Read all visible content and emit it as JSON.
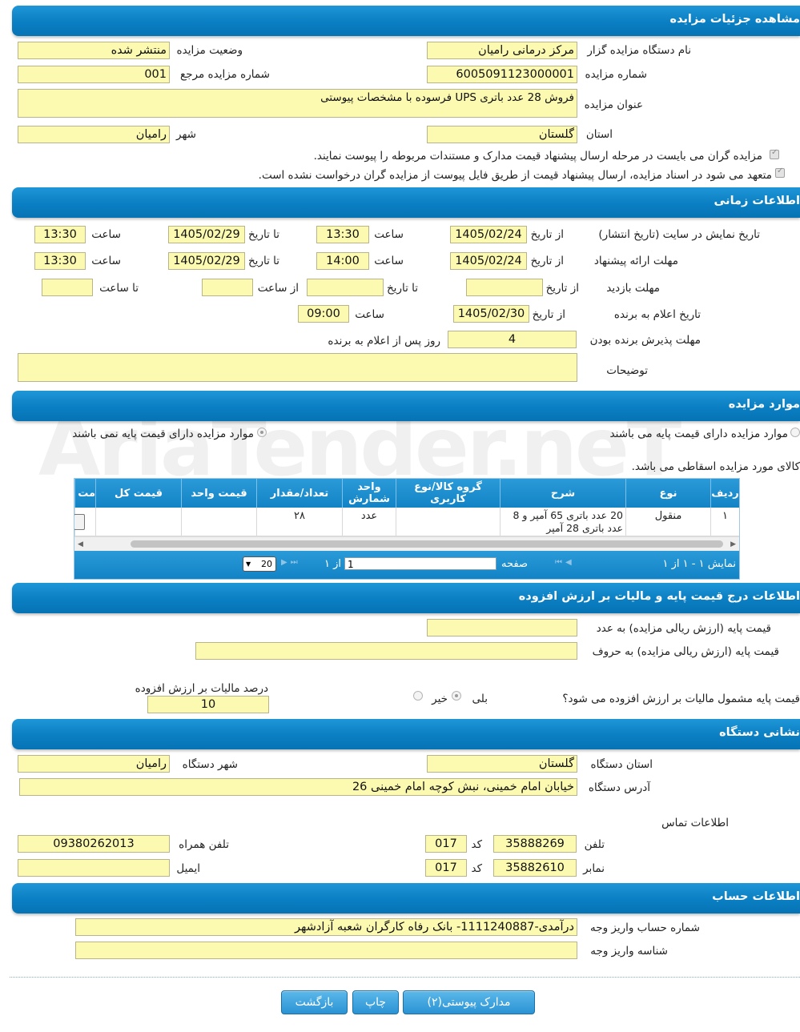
{
  "sections": {
    "details": "مشاهده جزئیات مزایده",
    "timing": "اطلاعات زمانی",
    "items": "موارد مزایده",
    "baseprice": "اطلاعات درج قیمت پایه و مالیات بر ارزش افزوده",
    "address": "نشانی دستگاه",
    "account": "اطلاعات حساب"
  },
  "details": {
    "org_name_label": "نام دستگاه مزایده گزار",
    "org_name": "مرکز درمانی رامیان",
    "status_label": "وضعیت مزایده",
    "status": "منتشر شده",
    "auction_no_label": "شماره مزایده",
    "auction_no": "6005091123000001",
    "ref_no_label": "شماره مزایده مرجع",
    "ref_no": "001",
    "title_label": "عنوان مزایده",
    "title": "فروش 28 عدد باتری UPS فرسوده با مشخصات پیوستی",
    "province_label": "استان",
    "province": "گلستان",
    "city_label": "شهر",
    "city": "رامیان",
    "check1": "مزایده گران می بایست در مرحله ارسال پیشنهاد قیمت مدارک و مستندات مربوطه را پیوست نمایند.",
    "check2": "متعهد می شود در اسناد مزایده، ارسال پیشنهاد قیمت از طریق فایل پیوست از مزایده گران درخواست نشده است."
  },
  "timing": {
    "row1_label": "تاریخ نمایش در سایت (تاریخ انتشار)",
    "row2_label": "مهلت ارائه پیشنهاد",
    "row3_label": "مهلت بازدید",
    "row4_label": "تاریخ اعلام به برنده",
    "row5_label": "مهلت پذیرش برنده بودن",
    "notes_label": "توضیحات",
    "from_date_label": "از تاریخ",
    "to_date_label": "تا تاریخ",
    "time_label": "ساعت",
    "from_time_label": "از ساعت",
    "to_time_label": "تا ساعت",
    "r1_from_date": "1405/02/24",
    "r1_from_time": "13:30",
    "r1_to_date": "1405/02/29",
    "r1_to_time": "13:30",
    "r2_from_date": "1405/02/24",
    "r2_from_time": "14:00",
    "r2_to_date": "1405/02/29",
    "r2_to_time": "13:30",
    "r4_date": "1405/02/30",
    "r4_time": "09:00",
    "r5_days": "4",
    "r5_suffix": "روز پس از اعلام به برنده"
  },
  "items": {
    "radio1": "موارد مزایده دارای قیمت پایه می باشند",
    "radio2": "موارد مزایده دارای قیمت پایه نمی باشند",
    "note": "کالای مورد مزایده اسقاطی می باشد.",
    "columns": [
      "ردیف",
      "نوع",
      "شرح",
      "گروه کالا/نوع کاربری",
      "واحد شمارش",
      "تعداد/مقدار",
      "قیمت واحد",
      "قیمت کل",
      "مت"
    ],
    "row": {
      "idx": "۱",
      "type": "منقول",
      "desc": "20 عدد باتری 65 آمپر و 8 عدد باتری 28 آمپر",
      "group": "",
      "unit": "عدد",
      "qty": "۲۸",
      "unit_price": "",
      "total": ""
    },
    "pager": {
      "display": "نمایش ۱ - ۱ از ۱",
      "page_label": "صفحه",
      "page_value": "1",
      "of_label": "از ۱",
      "page_size": "20"
    }
  },
  "baseprice": {
    "numeric_label": "قیمت پایه (ارزش ریالی مزایده) به عدد",
    "words_label": "قیمت پایه (ارزش ریالی مزایده) به حروف",
    "vat_question": "قیمت پایه مشمول مالیات بر ارزش افزوده می شود؟",
    "yes": "بلی",
    "no": "خیر",
    "vat_percent_label": "درصد مالیات بر ارزش افزوده",
    "vat_percent": "10"
  },
  "address": {
    "province_label": "استان دستگاه",
    "province": "گلستان",
    "city_label": "شهر دستگاه",
    "city": "رامیان",
    "addr_label": "آدرس دستگاه",
    "addr": "خیابان امام خمینی، نبش کوچه امام خمینی 26",
    "contact_label": "اطلاعات تماس",
    "phone_label": "تلفن",
    "phone": "35888269",
    "code_label": "کد",
    "phone_code": "017",
    "mobile_label": "تلفن همراه",
    "mobile": "09380262013",
    "fax_label": "نمابر",
    "fax": "35882610",
    "fax_code": "017",
    "email_label": "ایمیل",
    "email": ""
  },
  "account": {
    "acc_label": "شماره حساب واریز وجه",
    "acc": "درآمدی-1111240887- بانک رفاه کارگران شعبه آزادشهر",
    "id_label": "شناسه واریز وجه",
    "id": ""
  },
  "buttons": {
    "attachments": "مدارک پیوستی(۲)",
    "print": "چاپ",
    "back": "بازگشت"
  },
  "watermark": "AriaTender.neT",
  "colors": {
    "header": "#0a7fc3",
    "field": "#fcfab0"
  }
}
